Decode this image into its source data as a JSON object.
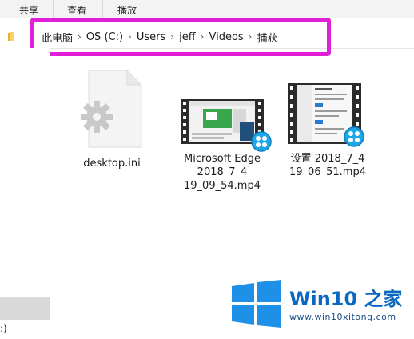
{
  "ribbon": {
    "tabs": [
      "共享",
      "查看",
      "播放"
    ]
  },
  "address": {
    "crumbs": [
      "此电脑",
      "OS (C:)",
      "Users",
      "jeff",
      "Videos",
      "捕获"
    ]
  },
  "files": [
    {
      "name": "desktop.ini",
      "icon": "settings-file-icon"
    },
    {
      "name_line1": "Microsoft Edge",
      "name_line2": "2018_7_4",
      "name_line3": "19_09_54.mp4",
      "icon": "video-thumbnail-icon"
    },
    {
      "name_line1": "设置 2018_7_4",
      "name_line2": "19_06_51.mp4",
      "icon": "video-thumbnail-icon"
    }
  ],
  "nav": {
    "drive_text": ":)"
  },
  "watermark": {
    "title_prefix": "Win10",
    "title_suffix": "之家",
    "url": "www.win10xitong.com"
  },
  "colors": {
    "highlight": "#e01fd7",
    "brand_blue": "#0a68c2",
    "folder_yellow": "#f0c14b"
  }
}
